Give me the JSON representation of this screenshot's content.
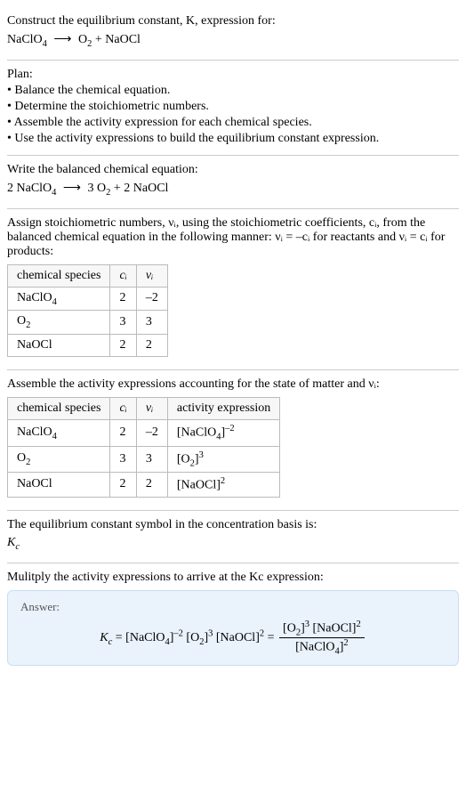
{
  "intro": {
    "line1": "Construct the equilibrium constant, K, expression for:",
    "eq_lhs": "NaClO",
    "eq_lhs_sub": "4",
    "eq_rhs1": "O",
    "eq_rhs1_sub": "2",
    "eq_rhs2": "NaOCl"
  },
  "plan": {
    "heading": "Plan:",
    "b1": "• Balance the chemical equation.",
    "b2": "• Determine the stoichiometric numbers.",
    "b3": "• Assemble the activity expression for each chemical species.",
    "b4": "• Use the activity expressions to build the equilibrium constant expression."
  },
  "balanced": {
    "heading": "Write the balanced chemical equation:",
    "c1": "2 NaClO",
    "c1_sub": "4",
    "c2": "3 O",
    "c2_sub": "2",
    "c3": "2 NaOCl"
  },
  "stoich": {
    "text": "Assign stoichiometric numbers, νᵢ, using the stoichiometric coefficients, cᵢ, from the balanced chemical equation in the following manner: νᵢ = –cᵢ for reactants and νᵢ = cᵢ for products:",
    "h1": "chemical species",
    "h2": "cᵢ",
    "h3": "νᵢ",
    "r1c1": "NaClO",
    "r1c1_sub": "4",
    "r1c2": "2",
    "r1c3": "–2",
    "r2c1": "O",
    "r2c1_sub": "2",
    "r2c2": "3",
    "r2c3": "3",
    "r3c1": "NaOCl",
    "r3c2": "2",
    "r3c3": "2"
  },
  "activity": {
    "text": "Assemble the activity expressions accounting for the state of matter and νᵢ:",
    "h1": "chemical species",
    "h2": "cᵢ",
    "h3": "νᵢ",
    "h4": "activity expression",
    "r1c1": "NaClO",
    "r1c1_sub": "4",
    "r1c2": "2",
    "r1c3": "–2",
    "r1c4_base": "[NaClO",
    "r1c4_sub": "4",
    "r1c4_close": "]",
    "r1c4_sup": "–2",
    "r2c1": "O",
    "r2c1_sub": "2",
    "r2c2": "3",
    "r2c3": "3",
    "r2c4_base": "[O",
    "r2c4_sub": "2",
    "r2c4_close": "]",
    "r2c4_sup": "3",
    "r3c1": "NaOCl",
    "r3c2": "2",
    "r3c3": "2",
    "r3c4_base": "[NaOCl]",
    "r3c4_sup": "2"
  },
  "symbol": {
    "text": "The equilibrium constant symbol in the concentration basis is:",
    "kc": "K",
    "kc_sub": "c"
  },
  "multiply": {
    "text": "Mulitply the activity expressions to arrive at the Kc expression:"
  },
  "answer": {
    "label": "Answer:",
    "kc": "K",
    "kc_sub": "c",
    "eq": " = ",
    "t1": "[NaClO",
    "t1_sub": "4",
    "t1_close": "]",
    "t1_sup": "–2",
    "t2": "[O",
    "t2_sub": "2",
    "t2_close": "]",
    "t2_sup": "3",
    "t3": "[NaOCl]",
    "t3_sup": "2",
    "eq2": " = ",
    "num1": "[O",
    "num1_sub": "2",
    "num1_close": "]",
    "num1_sup": "3",
    "num2": "[NaOCl]",
    "num2_sup": "2",
    "den1": "[NaClO",
    "den1_sub": "4",
    "den1_close": "]",
    "den1_sup": "2"
  }
}
